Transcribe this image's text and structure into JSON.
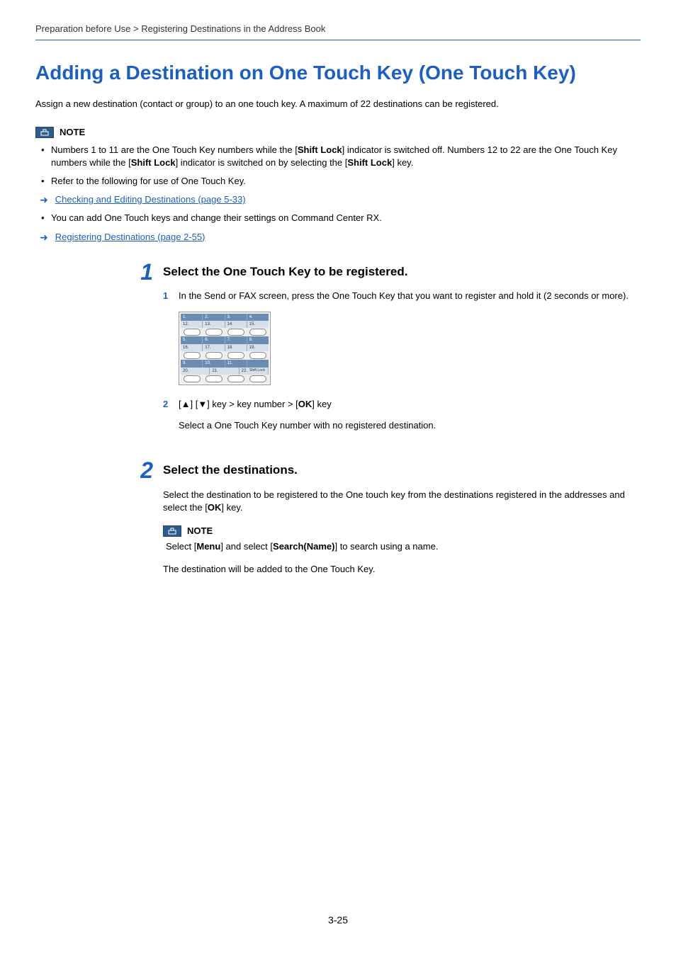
{
  "breadcrumb": "Preparation before Use > Registering Destinations in the Address Book",
  "title": "Adding a Destination on One Touch Key (One Touch Key)",
  "intro": "Assign a new destination (contact or group) to an one touch key. A maximum of 22 destinations can be registered.",
  "note_label": "NOTE",
  "note_bullet_1a": "Numbers 1 to 11 are the One Touch Key numbers while the [",
  "note_bullet_1b": "Shift Lock",
  "note_bullet_1c": "] indicator is switched off. Numbers 12 to 22 are the One Touch Key numbers while the [",
  "note_bullet_1d": "Shift Lock",
  "note_bullet_1e": "] indicator is switched on by selecting the [",
  "note_bullet_1f": "Shift Lock",
  "note_bullet_1g": "] key.",
  "note_bullet_2": "Refer to the following for use of One Touch Key.",
  "link_1": "Checking and Editing Destinations (page 5-33)",
  "note_bullet_3": "You can add One Touch keys and change their settings on Command Center RX.",
  "link_2": "Registering Destinations (page 2-55)",
  "step1_num": "1",
  "step1_title": "Select the One Touch Key to be registered.",
  "step1_sub1_num": "1",
  "step1_sub1_text": "In the Send or FAX screen, press the One Touch Key that you want to register and hold it (2 seconds or more).",
  "keypad_labels_r1": [
    "1.",
    "2.",
    "3.",
    "4."
  ],
  "keypad_labels_r1b": [
    "12.",
    "13.",
    "14.",
    "15."
  ],
  "keypad_labels_r2": [
    "5.",
    "6.",
    "7.",
    "8."
  ],
  "keypad_labels_r2b": [
    "16.",
    "17.",
    "18.",
    "19."
  ],
  "keypad_labels_r3": [
    "9.",
    "10.",
    "11.",
    ""
  ],
  "keypad_labels_r3b": [
    "20.",
    "21.",
    "22.",
    ""
  ],
  "keypad_shift": "Shift Lock",
  "step1_sub2_num": "2",
  "step1_sub2_a": "[▲] [▼] key > key number > [",
  "step1_sub2_b": "OK",
  "step1_sub2_c": "] key",
  "step1_sub2_note": "Select a One Touch Key number with no registered destination.",
  "step2_num": "2",
  "step2_title": "Select the destinations.",
  "step2_text_a": "Select the destination to be registered to the One touch key from the destinations registered in the addresses and select the [",
  "step2_text_b": "OK",
  "step2_text_c": "] key.",
  "step2_note_a": "Select [",
  "step2_note_b": "Menu",
  "step2_note_c": "] and select [",
  "step2_note_d": "Search(Name)",
  "step2_note_e": "] to search using a name.",
  "step2_final": "The destination will be added to the One Touch Key.",
  "page_number": "3-25"
}
